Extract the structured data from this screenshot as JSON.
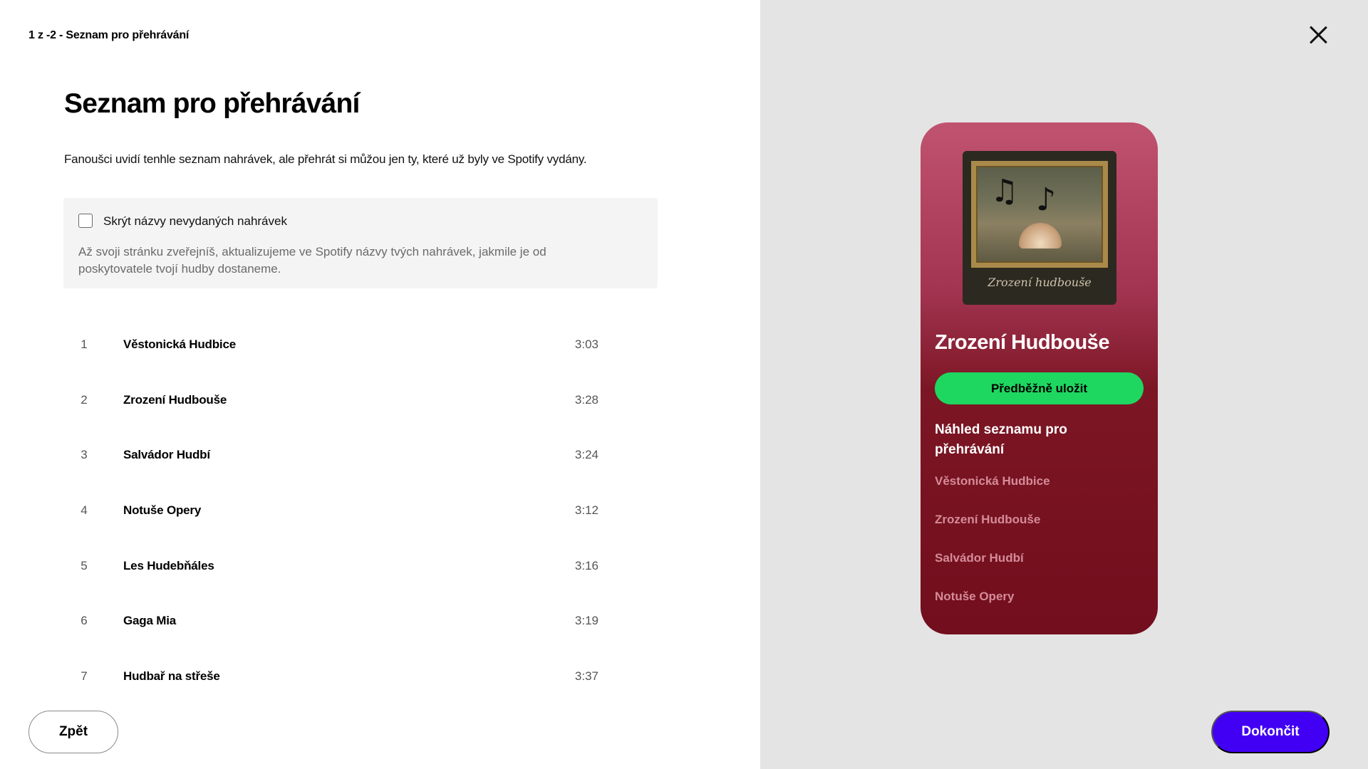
{
  "header": {
    "step_label": "1 z -2 - Seznam pro přehrávání"
  },
  "main": {
    "title": "Seznam pro přehrávání",
    "description": "Fanoušci uvidí tenhle seznam nahrávek, ale přehrát si můžou jen ty, které už byly ve Spotify vydány.",
    "hide_unreleased": {
      "label": "Skrýt názvy nevydaných nahrávek",
      "checked": false,
      "info": "Až svoji stránku zveřejníš, aktualizujeme ve Spotify názvy tvých nahrávek, jakmile je od poskytovatele tvojí hudby dostaneme."
    },
    "tracks": [
      {
        "num": "1",
        "name": "Věstonická Hudbice",
        "duration": "3:03"
      },
      {
        "num": "2",
        "name": "Zrození Hudbouše",
        "duration": "3:28"
      },
      {
        "num": "3",
        "name": "Salvádor Hudbí",
        "duration": "3:24"
      },
      {
        "num": "4",
        "name": "Notuše Opery",
        "duration": "3:12"
      },
      {
        "num": "5",
        "name": "Les Hudebňáles",
        "duration": "3:16"
      },
      {
        "num": "6",
        "name": "Gaga Mia",
        "duration": "3:19"
      },
      {
        "num": "7",
        "name": "Hudbař na střeše",
        "duration": "3:37"
      }
    ]
  },
  "footer": {
    "back_label": "Zpět",
    "finish_label": "Dokončit"
  },
  "preview": {
    "cover_caption": "Zrození hudbouše",
    "album_title": "Zrození Hudbouše",
    "save_label": "Předběžně uložit",
    "heading": "Náhled seznamu pro přehrávání",
    "items": [
      "Věstonická Hudbice",
      "Zrození Hudbouše",
      "Salvádor Hudbí",
      "Notuše Opery"
    ]
  },
  "colors": {
    "accent_purple": "#4100f4",
    "spotify_green": "#1ed760",
    "preview_bg_top": "#c0536f",
    "preview_bg_bottom": "#720e1d",
    "right_panel_bg": "#e4e4e4"
  },
  "icons": {
    "close": "close-icon",
    "checkbox": "checkbox-icon"
  }
}
